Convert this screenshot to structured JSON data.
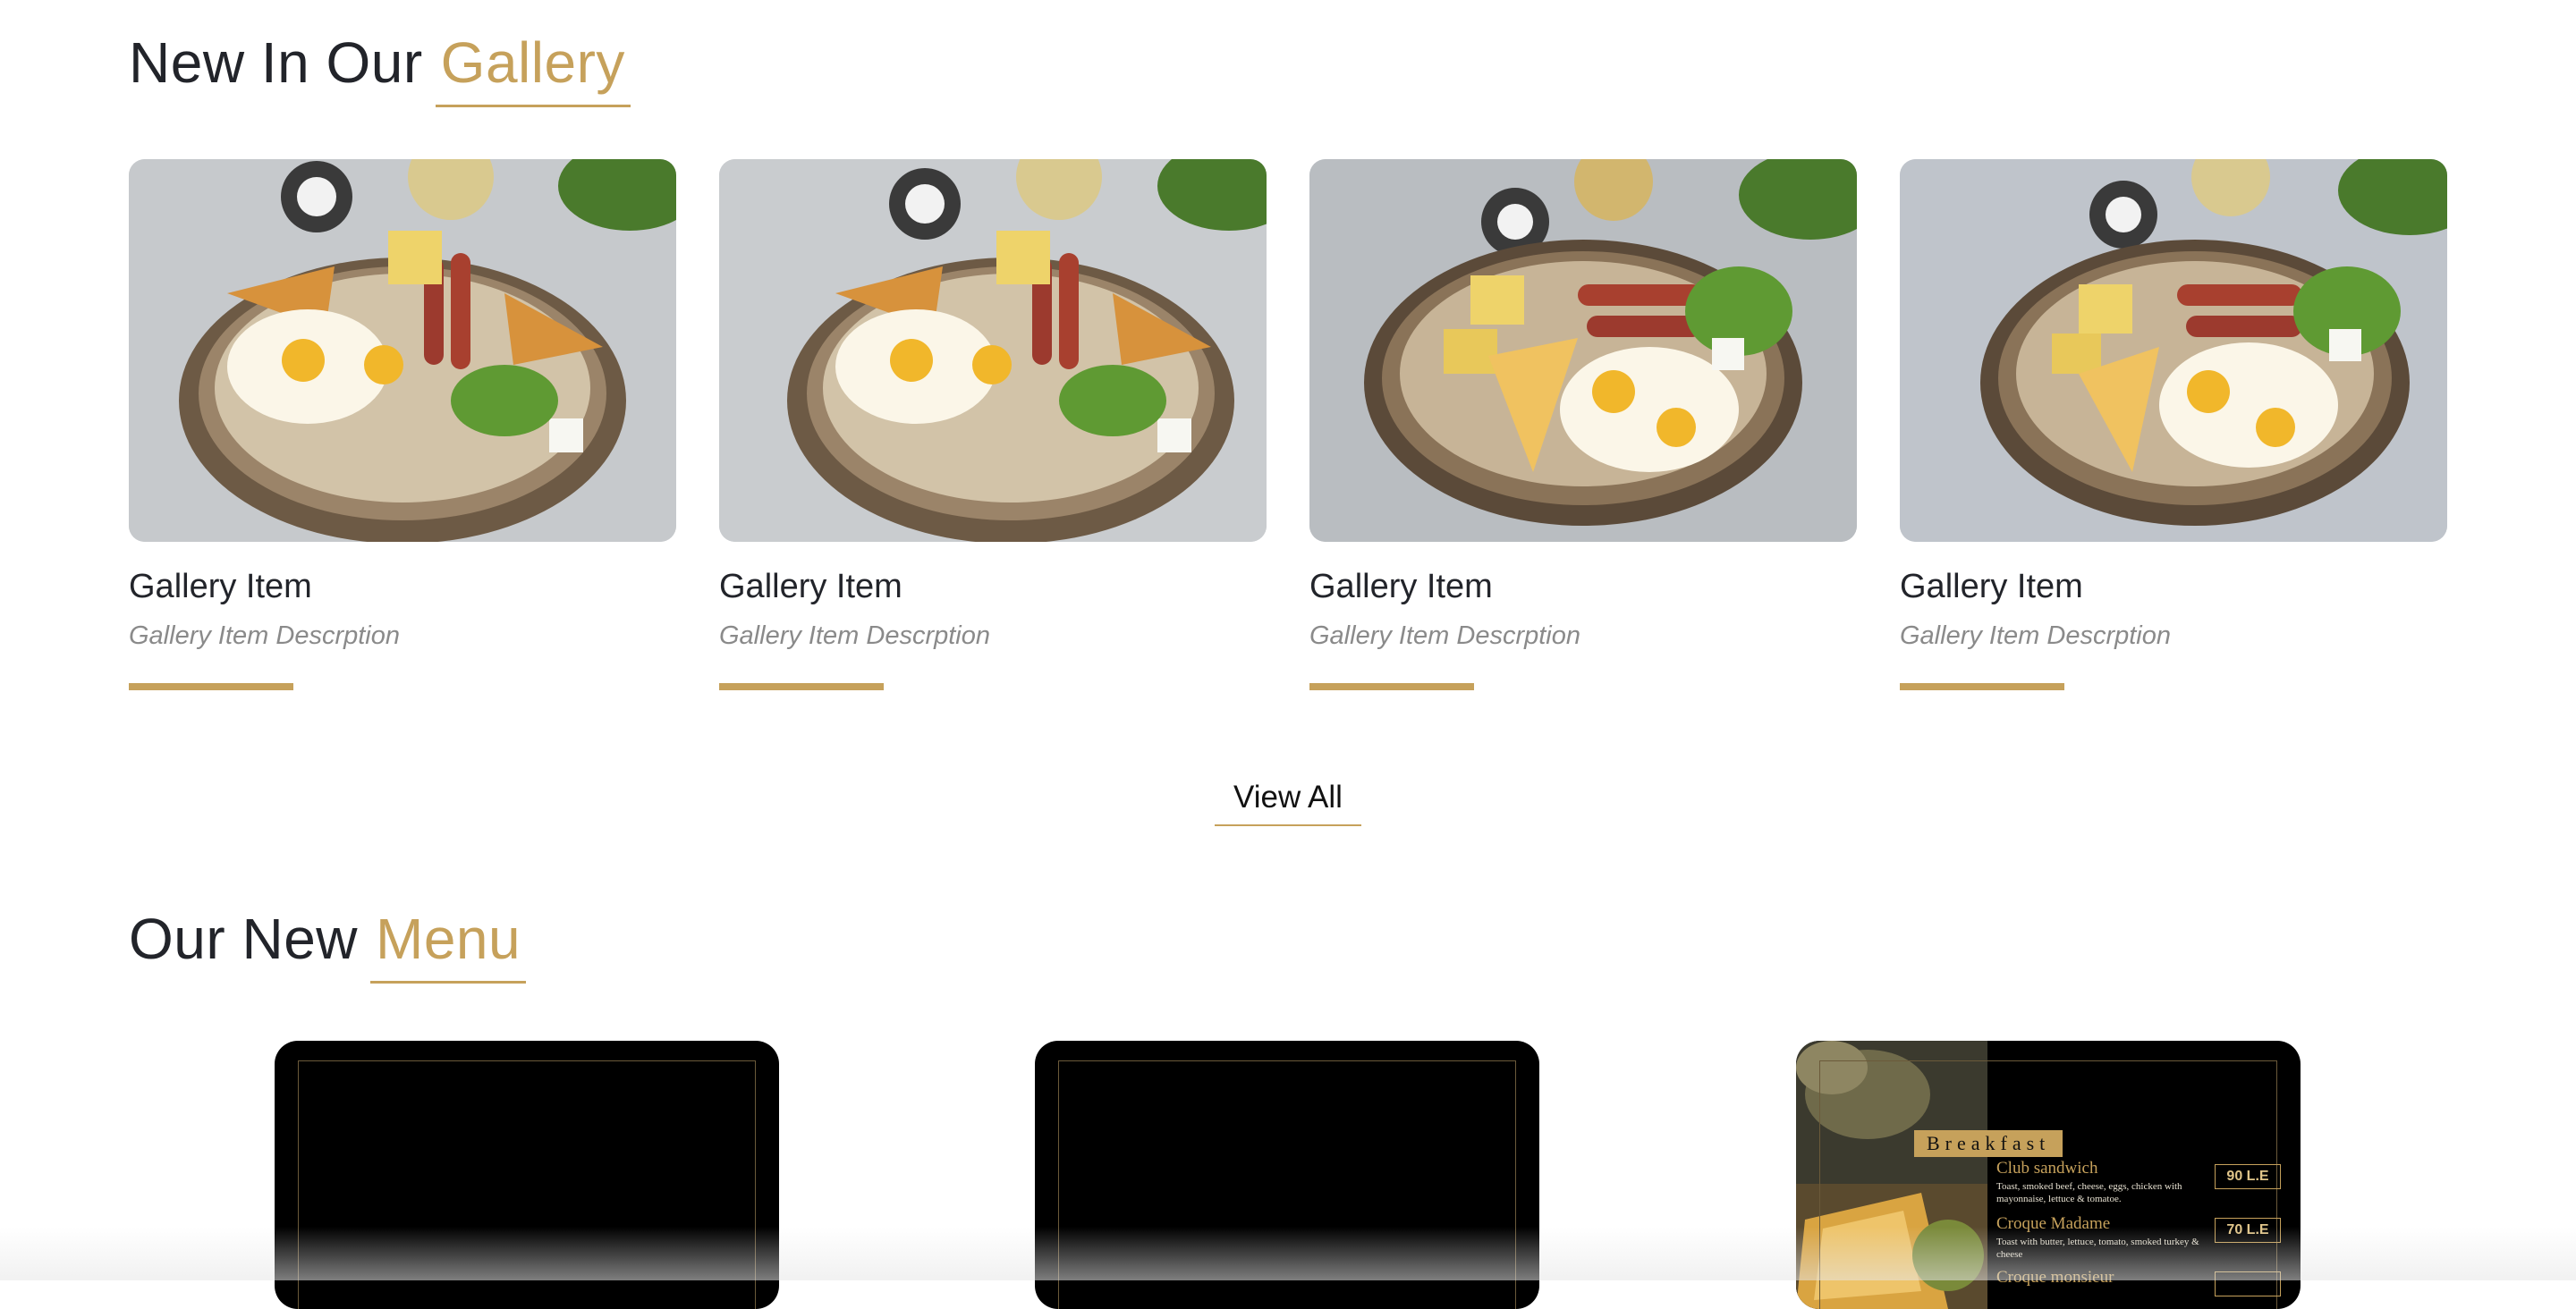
{
  "gallery_section": {
    "title_main": "New In Our",
    "title_accent": "Gallery",
    "items": [
      {
        "name": "Gallery Item",
        "description": "Gallery Item Descrption"
      },
      {
        "name": "Gallery Item",
        "description": "Gallery Item Descrption"
      },
      {
        "name": "Gallery Item",
        "description": "Gallery Item Descrption"
      },
      {
        "name": "Gallery Item",
        "description": "Gallery Item Descrption"
      }
    ],
    "view_all_label": "View All"
  },
  "menu_section": {
    "title_main": "Our New",
    "title_accent": "Menu",
    "breakfast_card": {
      "heading": "Breakfast",
      "items": [
        {
          "name": "Club sandwich",
          "description": "Toast, smoked beef, cheese, eggs, chicken with mayonnaise, lettuce & tomatoe.",
          "price": "90 L.E"
        },
        {
          "name": "Croque Madame",
          "description": "Toast with butter, lettuce, tomato, smoked turkey & cheese",
          "price": "70 L.E"
        },
        {
          "name": "Croque monsieur",
          "description": "",
          "price": ""
        }
      ]
    }
  },
  "colors": {
    "accent": "#c6a15b",
    "text": "#22242a",
    "muted": "#8a8a8a"
  }
}
